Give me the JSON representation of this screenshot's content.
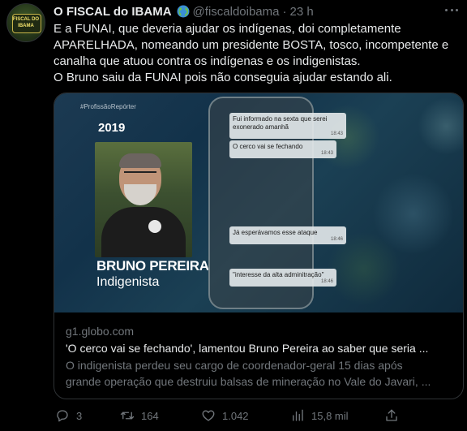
{
  "author": {
    "name": "O FISCAL do IBAMA",
    "handle": "@fiscaldoibama",
    "separator": "·",
    "time": "23 h",
    "avatar_text": [
      "FISCAL DO",
      "IBAMA"
    ],
    "name_emoji_icon": "globe-americas-icon"
  },
  "tweet": {
    "lines": [
      "E a FUNAI, que deveria ajudar os indígenas, doi completamente",
      "APARELHADA, nomeando um presidente  BOSTA, tosco, incompetente e",
      "canalha que atuou contra os indígenas e os indigenistas.",
      "O Bruno saiu da FUNAI pois não conseguia ajudar estando ali."
    ]
  },
  "card": {
    "image": {
      "hashtag": "#ProfissãoRepórter",
      "year": "2019",
      "person_name": "BRUNO PEREIRA",
      "person_role": "Indigenista",
      "messages": [
        {
          "text": "Fui informado na sexta que serei exonerado amanhã",
          "time": "18:43"
        },
        {
          "text": "O cerco vai se fechando",
          "time": "18:43"
        },
        {
          "text": "Já esperávamos esse ataque",
          "time": "18:46"
        },
        {
          "text": "\"interesse da alta adminitração\"",
          "time": "18:46"
        }
      ]
    },
    "domain": "g1.globo.com",
    "title": "'O cerco vai se fechando', lamentou Bruno Pereira ao saber que seria ...",
    "description_lines": [
      "O indigenista perdeu seu cargo de coordenador-geral 15 dias após",
      "grande operação que destruiu balsas de mineração no Vale do Javari, ..."
    ]
  },
  "actions": {
    "reply_count": "3",
    "retweet_count": "164",
    "like_count": "1.042",
    "views_count": "15,8 mil"
  },
  "colors": {
    "background": "#000000",
    "text": "#e7e9ea",
    "muted": "#71767b",
    "border": "#2f3336"
  }
}
